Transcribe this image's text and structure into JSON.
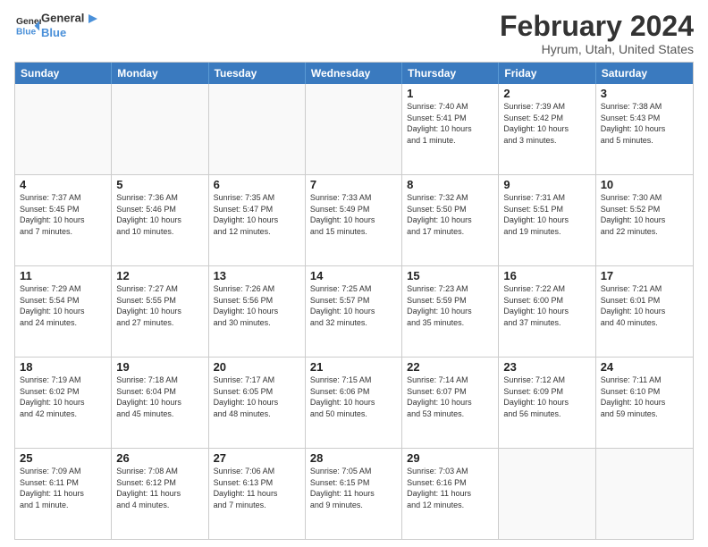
{
  "header": {
    "logo_general": "General",
    "logo_blue": "Blue",
    "month_title": "February 2024",
    "location": "Hyrum, Utah, United States"
  },
  "days_of_week": [
    "Sunday",
    "Monday",
    "Tuesday",
    "Wednesday",
    "Thursday",
    "Friday",
    "Saturday"
  ],
  "rows": [
    [
      {
        "date": "",
        "info": ""
      },
      {
        "date": "",
        "info": ""
      },
      {
        "date": "",
        "info": ""
      },
      {
        "date": "",
        "info": ""
      },
      {
        "date": "1",
        "info": "Sunrise: 7:40 AM\nSunset: 5:41 PM\nDaylight: 10 hours\nand 1 minute."
      },
      {
        "date": "2",
        "info": "Sunrise: 7:39 AM\nSunset: 5:42 PM\nDaylight: 10 hours\nand 3 minutes."
      },
      {
        "date": "3",
        "info": "Sunrise: 7:38 AM\nSunset: 5:43 PM\nDaylight: 10 hours\nand 5 minutes."
      }
    ],
    [
      {
        "date": "4",
        "info": "Sunrise: 7:37 AM\nSunset: 5:45 PM\nDaylight: 10 hours\nand 7 minutes."
      },
      {
        "date": "5",
        "info": "Sunrise: 7:36 AM\nSunset: 5:46 PM\nDaylight: 10 hours\nand 10 minutes."
      },
      {
        "date": "6",
        "info": "Sunrise: 7:35 AM\nSunset: 5:47 PM\nDaylight: 10 hours\nand 12 minutes."
      },
      {
        "date": "7",
        "info": "Sunrise: 7:33 AM\nSunset: 5:49 PM\nDaylight: 10 hours\nand 15 minutes."
      },
      {
        "date": "8",
        "info": "Sunrise: 7:32 AM\nSunset: 5:50 PM\nDaylight: 10 hours\nand 17 minutes."
      },
      {
        "date": "9",
        "info": "Sunrise: 7:31 AM\nSunset: 5:51 PM\nDaylight: 10 hours\nand 19 minutes."
      },
      {
        "date": "10",
        "info": "Sunrise: 7:30 AM\nSunset: 5:52 PM\nDaylight: 10 hours\nand 22 minutes."
      }
    ],
    [
      {
        "date": "11",
        "info": "Sunrise: 7:29 AM\nSunset: 5:54 PM\nDaylight: 10 hours\nand 24 minutes."
      },
      {
        "date": "12",
        "info": "Sunrise: 7:27 AM\nSunset: 5:55 PM\nDaylight: 10 hours\nand 27 minutes."
      },
      {
        "date": "13",
        "info": "Sunrise: 7:26 AM\nSunset: 5:56 PM\nDaylight: 10 hours\nand 30 minutes."
      },
      {
        "date": "14",
        "info": "Sunrise: 7:25 AM\nSunset: 5:57 PM\nDaylight: 10 hours\nand 32 minutes."
      },
      {
        "date": "15",
        "info": "Sunrise: 7:23 AM\nSunset: 5:59 PM\nDaylight: 10 hours\nand 35 minutes."
      },
      {
        "date": "16",
        "info": "Sunrise: 7:22 AM\nSunset: 6:00 PM\nDaylight: 10 hours\nand 37 minutes."
      },
      {
        "date": "17",
        "info": "Sunrise: 7:21 AM\nSunset: 6:01 PM\nDaylight: 10 hours\nand 40 minutes."
      }
    ],
    [
      {
        "date": "18",
        "info": "Sunrise: 7:19 AM\nSunset: 6:02 PM\nDaylight: 10 hours\nand 42 minutes."
      },
      {
        "date": "19",
        "info": "Sunrise: 7:18 AM\nSunset: 6:04 PM\nDaylight: 10 hours\nand 45 minutes."
      },
      {
        "date": "20",
        "info": "Sunrise: 7:17 AM\nSunset: 6:05 PM\nDaylight: 10 hours\nand 48 minutes."
      },
      {
        "date": "21",
        "info": "Sunrise: 7:15 AM\nSunset: 6:06 PM\nDaylight: 10 hours\nand 50 minutes."
      },
      {
        "date": "22",
        "info": "Sunrise: 7:14 AM\nSunset: 6:07 PM\nDaylight: 10 hours\nand 53 minutes."
      },
      {
        "date": "23",
        "info": "Sunrise: 7:12 AM\nSunset: 6:09 PM\nDaylight: 10 hours\nand 56 minutes."
      },
      {
        "date": "24",
        "info": "Sunrise: 7:11 AM\nSunset: 6:10 PM\nDaylight: 10 hours\nand 59 minutes."
      }
    ],
    [
      {
        "date": "25",
        "info": "Sunrise: 7:09 AM\nSunset: 6:11 PM\nDaylight: 11 hours\nand 1 minute."
      },
      {
        "date": "26",
        "info": "Sunrise: 7:08 AM\nSunset: 6:12 PM\nDaylight: 11 hours\nand 4 minutes."
      },
      {
        "date": "27",
        "info": "Sunrise: 7:06 AM\nSunset: 6:13 PM\nDaylight: 11 hours\nand 7 minutes."
      },
      {
        "date": "28",
        "info": "Sunrise: 7:05 AM\nSunset: 6:15 PM\nDaylight: 11 hours\nand 9 minutes."
      },
      {
        "date": "29",
        "info": "Sunrise: 7:03 AM\nSunset: 6:16 PM\nDaylight: 11 hours\nand 12 minutes."
      },
      {
        "date": "",
        "info": ""
      },
      {
        "date": "",
        "info": ""
      }
    ]
  ]
}
